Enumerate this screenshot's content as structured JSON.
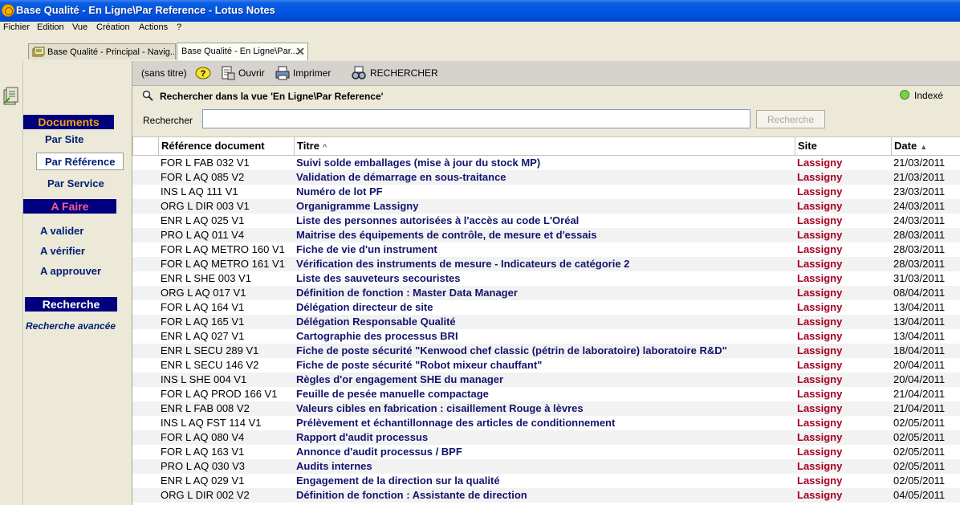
{
  "window": {
    "title": "Base Qualité - En Ligne\\Par Reference - Lotus Notes"
  },
  "menu": [
    "Fichier",
    "Edition",
    "Vue",
    "Création",
    "Actions",
    "?"
  ],
  "tabs": [
    {
      "label": "Base Qualité - Principal - Navig..."
    },
    {
      "label": "Base Qualité - En Ligne\\Par..."
    }
  ],
  "toolbar": {
    "untitled": "(sans titre)",
    "open": "Ouvrir",
    "print": "Imprimer",
    "search": "RECHERCHER"
  },
  "nav": {
    "documents": "Documents",
    "par_site": "Par Site",
    "par_reference": "Par Référence",
    "par_service": "Par Service",
    "a_faire": "A Faire",
    "a_valider": "A valider",
    "a_verifier": "A vérifier",
    "a_approuver": "A approuver",
    "recherche": "Recherche",
    "recherche_avancee": "Recherche avancée"
  },
  "search": {
    "title": "Rechercher dans la vue 'En Ligne\\Par Reference'",
    "indexed": "Indexé",
    "label": "Rechercher",
    "value": "",
    "button": "Recherche"
  },
  "columns": {
    "ref": "Référence document",
    "title": "Titre",
    "site": "Site",
    "date": "Date"
  },
  "rows": [
    {
      "ref": "FOR L FAB 032 V1",
      "title": "Suivi solde emballages (mise à jour du stock MP)",
      "site": "Lassigny",
      "date": "21/03/2011"
    },
    {
      "ref": "FOR L AQ 085 V2",
      "title": "Validation de démarrage en sous-traitance",
      "site": "Lassigny",
      "date": "21/03/2011"
    },
    {
      "ref": "INS L AQ 111 V1",
      "title": "Numéro de lot PF",
      "site": "Lassigny",
      "date": "23/03/2011"
    },
    {
      "ref": "ORG L DIR 003 V1",
      "title": "Organigramme Lassigny",
      "site": "Lassigny",
      "date": "24/03/2011"
    },
    {
      "ref": "ENR L AQ 025 V1",
      "title": "Liste des personnes autorisées à l'accès au code L'Oréal",
      "site": "Lassigny",
      "date": "24/03/2011"
    },
    {
      "ref": "PRO L AQ 011 V4",
      "title": "Maitrise des équipements de contrôle, de mesure et d'essais",
      "site": "Lassigny",
      "date": "28/03/2011"
    },
    {
      "ref": "FOR L AQ METRO 160 V1",
      "title": "Fiche de vie d'un instrument",
      "site": "Lassigny",
      "date": "28/03/2011"
    },
    {
      "ref": "FOR L AQ METRO 161 V1",
      "title": "Vérification des instruments de mesure - Indicateurs de catégorie 2",
      "site": "Lassigny",
      "date": "28/03/2011"
    },
    {
      "ref": "ENR L SHE 003 V1",
      "title": "Liste des sauveteurs secouristes",
      "site": "Lassigny",
      "date": "31/03/2011"
    },
    {
      "ref": "ORG L AQ 017 V1",
      "title": "Définition de fonction : Master Data Manager",
      "site": "Lassigny",
      "date": "08/04/2011"
    },
    {
      "ref": "FOR L AQ 164 V1",
      "title": "Délégation directeur de site",
      "site": "Lassigny",
      "date": "13/04/2011"
    },
    {
      "ref": "FOR L AQ 165 V1",
      "title": "Délégation Responsable Qualité",
      "site": "Lassigny",
      "date": "13/04/2011"
    },
    {
      "ref": "ENR L AQ 027 V1",
      "title": "Cartographie des processus BRI",
      "site": "Lassigny",
      "date": "13/04/2011"
    },
    {
      "ref": "ENR L SECU 289 V1",
      "title": "Fiche de poste sécurité \"Kenwood chef classic (pétrin de laboratoire) laboratoire R&D\"",
      "site": "Lassigny",
      "date": "18/04/2011"
    },
    {
      "ref": "ENR L SECU 146 V2",
      "title": "Fiche de poste sécurité \"Robot mixeur chauffant\"",
      "site": "Lassigny",
      "date": "20/04/2011"
    },
    {
      "ref": "INS L SHE 004 V1",
      "title": "Règles d'or engagement SHE du manager",
      "site": "Lassigny",
      "date": "20/04/2011"
    },
    {
      "ref": "FOR L AQ PROD 166 V1",
      "title": "Feuille de pesée manuelle compactage",
      "site": "Lassigny",
      "date": "21/04/2011"
    },
    {
      "ref": "ENR L FAB 008 V2",
      "title": "Valeurs cibles en fabrication : cisaillement Rouge à lèvres",
      "site": "Lassigny",
      "date": "21/04/2011"
    },
    {
      "ref": "INS L AQ FST 114 V1",
      "title": "Prélèvement et échantillonnage des articles de conditionnement",
      "site": "Lassigny",
      "date": "02/05/2011"
    },
    {
      "ref": "FOR L AQ 080 V4",
      "title": "Rapport d'audit processus",
      "site": "Lassigny",
      "date": "02/05/2011"
    },
    {
      "ref": "FOR L AQ 163 V1",
      "title": "Annonce d'audit processus / BPF",
      "site": "Lassigny",
      "date": "02/05/2011"
    },
    {
      "ref": "PRO L AQ 030 V3",
      "title": "Audits internes",
      "site": "Lassigny",
      "date": "02/05/2011"
    },
    {
      "ref": "ENR L AQ 029 V1",
      "title": "Engagement de la direction sur la qualité",
      "site": "Lassigny",
      "date": "02/05/2011"
    },
    {
      "ref": "ORG L DIR 002 V2",
      "title": "Définition de fonction : Assistante de direction",
      "site": "Lassigny",
      "date": "04/05/2011"
    }
  ]
}
